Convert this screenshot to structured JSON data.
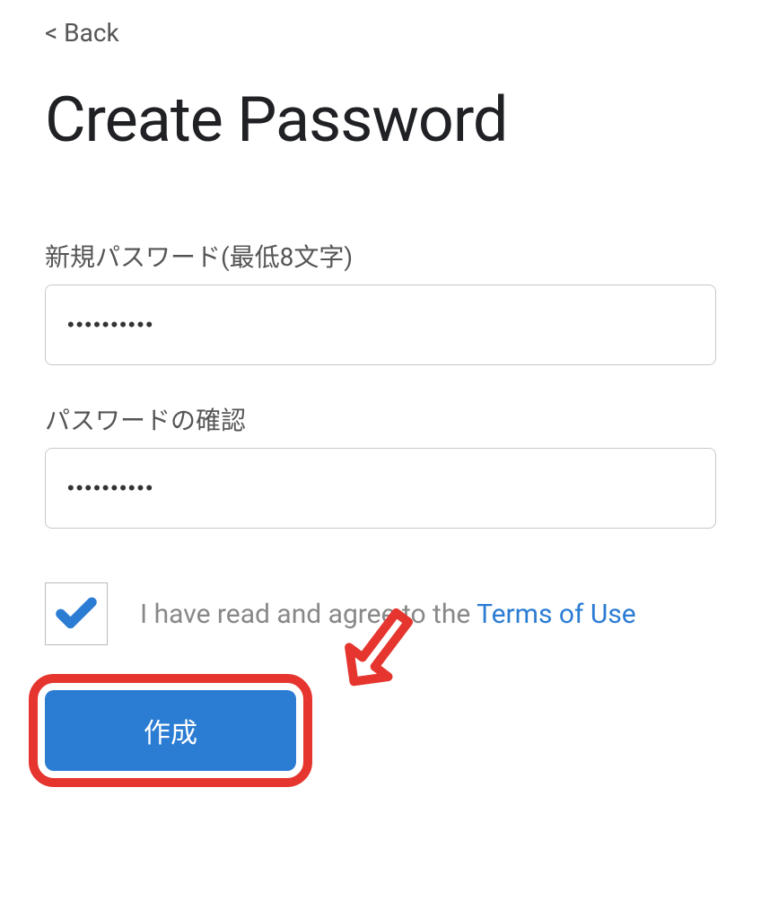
{
  "nav": {
    "back_label": "< Back"
  },
  "header": {
    "title": "Create Password"
  },
  "form": {
    "new_password": {
      "label": "新規パスワード(最低8文字)",
      "value": "••••••••••"
    },
    "confirm_password": {
      "label": "パスワードの確認",
      "value": "••••••••••"
    },
    "consent": {
      "prefix_text": "I have read and agree to the ",
      "terms_link_text": "Terms of Use",
      "checked": true
    },
    "submit_label": "作成"
  },
  "annotation": {
    "highlight_target": "submit-button",
    "arrow_icon": "arrow-down-left-icon"
  },
  "colors": {
    "primary": "#2b7cd3",
    "highlight": "#e5352e",
    "text_muted": "#888",
    "border": "#c8c8c8"
  }
}
